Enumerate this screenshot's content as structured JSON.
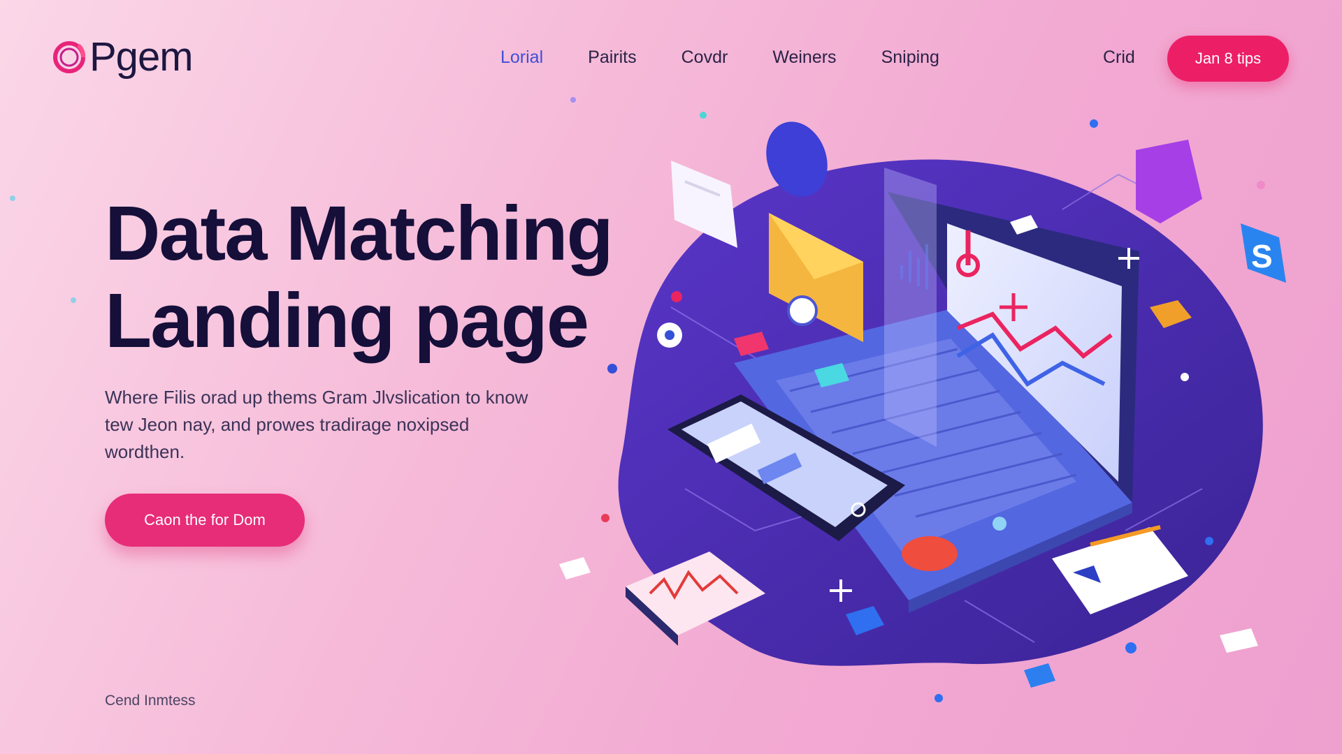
{
  "brand": {
    "logo_text": "Pgem"
  },
  "nav": {
    "items": [
      {
        "label": "Lorial",
        "active": true
      },
      {
        "label": "Pairits",
        "active": false
      },
      {
        "label": "Covdr",
        "active": false
      },
      {
        "label": "Weiners",
        "active": false
      },
      {
        "label": "Sniping",
        "active": false
      }
    ],
    "right_link": "Crid",
    "cta_label": "Jan 8 tips"
  },
  "hero": {
    "title_line1": "Data Matching",
    "title_line2": "Landing page",
    "description": "Where Filis orad up thems Gram Jlvslication to know tew Jeon nay, and prowes tradirage noxipsed wordthen.",
    "cta_label": "Caon the for Dom"
  },
  "footer": {
    "link_label": "Cend Inmtess"
  },
  "colors": {
    "accent": "#ec1f66",
    "nav_active": "#3f4fd8",
    "title": "#150f3a",
    "blob": "#4b2fb8",
    "background": "#f6bcd9"
  },
  "icons": [
    "logo-ring-icon",
    "laptop-icon",
    "smartphone-icon",
    "envelope-icon",
    "chart-card-icon",
    "s-badge-icon",
    "plus-icon"
  ]
}
